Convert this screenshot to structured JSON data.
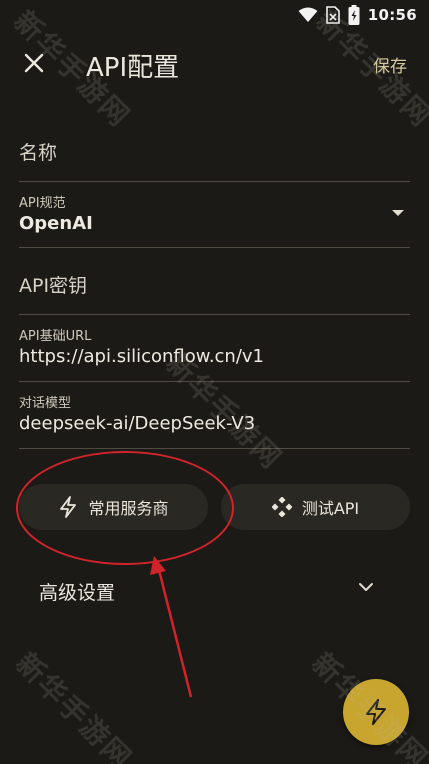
{
  "status_bar": {
    "time": "10:56",
    "icons": [
      "wifi-icon",
      "sim-icon",
      "battery-icon"
    ]
  },
  "app_bar": {
    "close_icon": "close-icon",
    "title": "API配置",
    "save_label": "保存"
  },
  "form": {
    "name": {
      "placeholder": "名称"
    },
    "api_spec": {
      "label": "API规范",
      "value": "OpenAI"
    },
    "api_key": {
      "placeholder": "API密钥"
    },
    "base_url": {
      "label": "API基础URL",
      "value": "https://api.siliconflow.cn/v1"
    },
    "chat_model": {
      "label": "对话模型",
      "value": "deepseek-ai/DeepSeek-V3"
    }
  },
  "actions": {
    "providers_label": "常用服务商",
    "providers_icon": "lightning-icon",
    "test_label": "测试API",
    "test_icon": "diamond-dots-icon"
  },
  "advanced": {
    "label": "高级设置",
    "icon": "chevron-down-icon"
  },
  "fab": {
    "icon": "lightning-icon"
  },
  "annotation": {
    "color": "#d0242a"
  },
  "watermark": "新华手游网",
  "colors": {
    "background": "#1b1a16",
    "accent": "#c7a52e",
    "pill": "#2a2822"
  }
}
